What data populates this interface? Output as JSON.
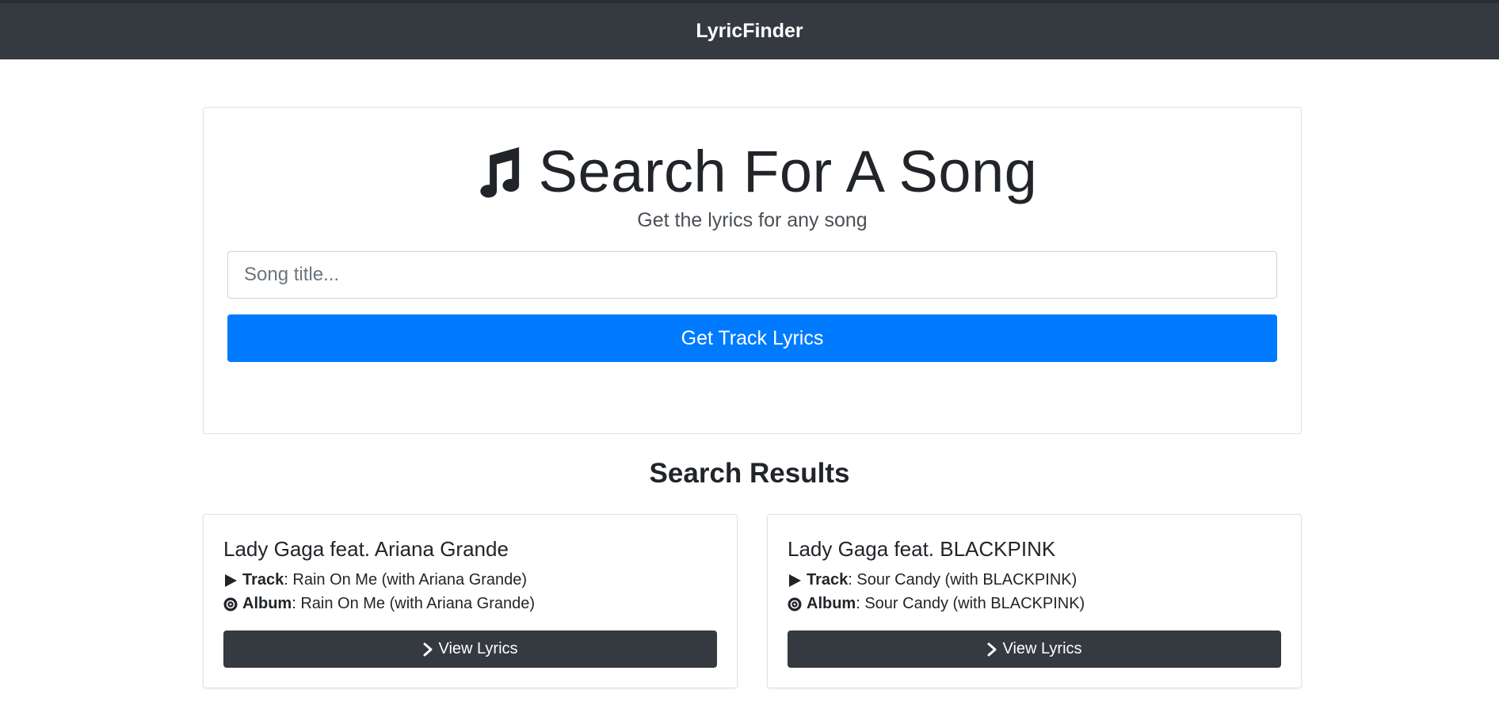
{
  "navbar": {
    "brand": "LyricFinder"
  },
  "search": {
    "title": "Search For A Song",
    "subtitle": "Get the lyrics for any song",
    "input_placeholder": "Song title...",
    "input_value": "",
    "button_label": "Get Track Lyrics",
    "title_icon": "music-note-icon"
  },
  "results": {
    "heading": "Search Results",
    "track_label": "Track",
    "album_label": "Album",
    "view_label": "View Lyrics",
    "items": [
      {
        "artist": "Lady Gaga feat. Ariana Grande",
        "track": ": Rain On Me (with Ariana Grande)",
        "album": ": Rain On Me (with Ariana Grande)"
      },
      {
        "artist": "Lady Gaga feat. BLACKPINK",
        "track": ": Sour Candy (with BLACKPINK)",
        "album": ": Sour Candy (with BLACKPINK)"
      }
    ]
  },
  "colors": {
    "navbar": "#343a40",
    "primary": "#007bff",
    "dark_button": "#343a40"
  }
}
